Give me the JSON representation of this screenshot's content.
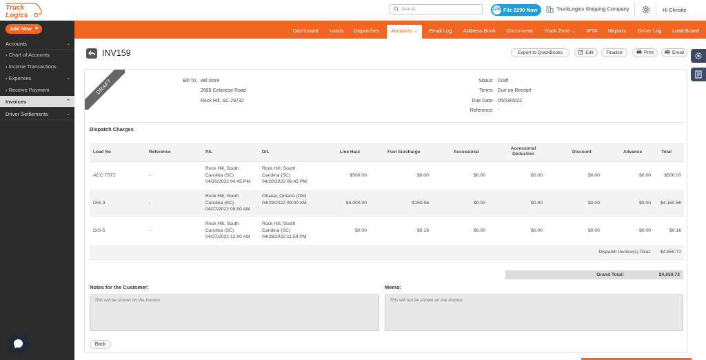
{
  "brand": {
    "logo_line1": "Truck",
    "logo_line2": "Logics",
    "accent": "#f26522",
    "sidebar_bg": "#2b2b2b"
  },
  "topbar": {
    "search_placeholder": "Search",
    "file_button": "File 2290 Now",
    "file_icon": "2290",
    "company": "TruckLogics Shipping Company",
    "greeting": "Hi Christie"
  },
  "sidebar": {
    "add_new": "Add New",
    "accounts": "Accounts",
    "items": [
      "Chart of Accounts",
      "Income Transactions",
      "Expenses",
      "Receive Payment"
    ],
    "invoices": "Invoices",
    "driver_settlements": "Driver Settlements"
  },
  "nav": {
    "items": [
      "Dashboard",
      "Loads",
      "Dispatches",
      "Accounts",
      "Email Log",
      "Address Book",
      "Documents",
      "Truck Zone",
      "IFTA",
      "Reports",
      "Driver Log",
      "Load Board"
    ],
    "active": "Accounts"
  },
  "header": {
    "title": "INV159",
    "export": "Export to QuickBooks",
    "edit": "Edit",
    "finalize": "Finalize",
    "print": "Print",
    "email": "Email"
  },
  "invoice": {
    "ribbon": "DRAFT",
    "bill_to_label": "Bill To:",
    "bill_to": [
      "will store",
      "2685 Celanese Road",
      "Rock Hill, SC 29732"
    ],
    "status_label": "Status:",
    "status": "Draft",
    "terms_label": "Terms:",
    "terms": "Due on Receipt",
    "due_label": "Due Date:",
    "due": "05/03/2022",
    "ref_label": "Reference:",
    "ref": "-"
  },
  "charges": {
    "title": "Dispatch Charges",
    "columns": [
      "Load No",
      "Reference",
      "P/L",
      "D/L",
      "Line Haul",
      "Fuel Surcharge",
      "Accessorial",
      "Accessorial Deduction",
      "Discount",
      "Advance",
      "Total"
    ],
    "rows": [
      {
        "load": "ACC TST2",
        "ref": "-",
        "pl": [
          "Rock Hill, South",
          "Carolina (SC)",
          "04/20/2022 04:45 PM"
        ],
        "dl": [
          "Rock Hill, South",
          "Carolina (SC)",
          "04/20/2022 06:45 PM"
        ],
        "line_haul": "$500.00",
        "fuel": "$0.00",
        "acc": "$0.00",
        "acc_ded": "$0.00",
        "discount": "$0.00",
        "advance": "$0.00",
        "total": "$500.00"
      },
      {
        "load": "DIS-3",
        "ref": "-",
        "pl": [
          "Rock Hill, South",
          "Carolina (SC)",
          "04/27/2022 09:00 AM"
        ],
        "dl": [
          "Ottawa, Ontario (ON)",
          "04/29/2022 09:00 AM"
        ],
        "line_haul": "$4,000.00",
        "fuel": "$150.56",
        "acc": "$0.00",
        "acc_ded": "$0.00",
        "discount": "$0.00",
        "advance": "$0.00",
        "total": "$4,150.56"
      },
      {
        "load": "DIS-5",
        "ref": "-",
        "pl": [
          "Rock Hill, South",
          "Carolina (SC)",
          "04/27/2022 12:00 AM"
        ],
        "dl": [
          "Rock Hill, South",
          "Carolina (SC)",
          "04/28/2022 11:59 PM"
        ],
        "line_haul": "$0.00",
        "fuel": "$0.16",
        "acc": "$0.00",
        "acc_ded": "$0.00",
        "discount": "$0.00",
        "advance": "$0.00",
        "total": "$0.16"
      }
    ],
    "subtotal_label": "Dispatch Invoice(s) Total:",
    "subtotal": "$4,650.72",
    "grand_label": "Grand Total:",
    "grand": "$4,650.72"
  },
  "notes": {
    "customer_title": "Notes for the Customer:",
    "customer_placeholder": "This will be shown on the Invoice",
    "memo_title": "Memo:",
    "memo_placeholder": "This will not be shown on the Invoice"
  },
  "footer": {
    "back": "Back"
  }
}
